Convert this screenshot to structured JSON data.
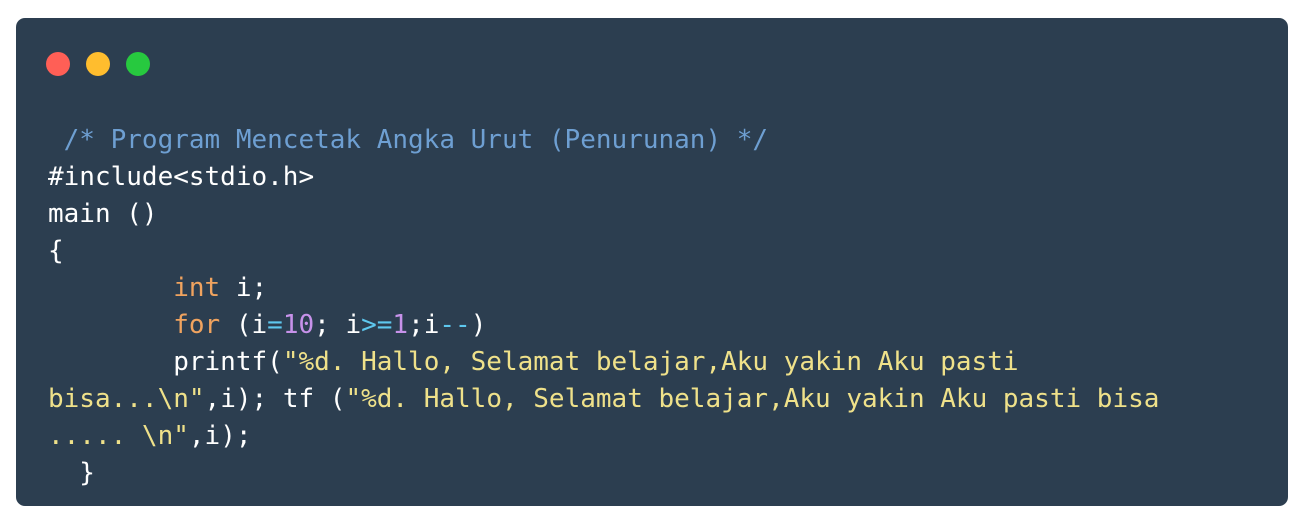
{
  "colors": {
    "window_bg": "#2c3e50",
    "dot_red": "#ff5f56",
    "dot_yellow": "#ffbd2e",
    "dot_green": "#27c93f",
    "default": "#ffffff",
    "comment": "#6e9fd2",
    "keyword": "#f0a35f",
    "string": "#efe18a",
    "number": "#c792ea",
    "operator": "#5ec8ef"
  },
  "window_controls": [
    "close",
    "minimize",
    "zoom"
  ],
  "code_lines": [
    [
      {
        "text": " /* Program Mencetak Angka Urut (Penurunan) */",
        "type": "comment"
      }
    ],
    [
      {
        "text": "#include<stdio.h>",
        "type": "default"
      }
    ],
    [
      {
        "text": "main ()",
        "type": "default"
      }
    ],
    [
      {
        "text": "{",
        "type": "default"
      }
    ],
    [
      {
        "text": "        ",
        "type": "default"
      },
      {
        "text": "int",
        "type": "keyword"
      },
      {
        "text": " i;",
        "type": "default"
      }
    ],
    [
      {
        "text": "        ",
        "type": "default"
      },
      {
        "text": "for",
        "type": "keyword"
      },
      {
        "text": " (i",
        "type": "default"
      },
      {
        "text": "=",
        "type": "operator"
      },
      {
        "text": "10",
        "type": "number"
      },
      {
        "text": "; i",
        "type": "default"
      },
      {
        "text": ">=",
        "type": "operator"
      },
      {
        "text": "1",
        "type": "number"
      },
      {
        "text": ";i",
        "type": "default"
      },
      {
        "text": "--",
        "type": "operator"
      },
      {
        "text": ")",
        "type": "default"
      }
    ],
    [
      {
        "text": "        printf(",
        "type": "default"
      },
      {
        "text": "\"%d. Hallo, Selamat belajar,Aku yakin Aku pasti",
        "type": "string"
      }
    ],
    [
      {
        "text": "bisa...\\n\"",
        "type": "string"
      },
      {
        "text": ",i); tf (",
        "type": "default"
      },
      {
        "text": "\"%d. Hallo, Selamat belajar,Aku yakin Aku pasti bisa",
        "type": "string"
      }
    ],
    [
      {
        "text": "..... \\n\"",
        "type": "string"
      },
      {
        "text": ",i);",
        "type": "default"
      }
    ],
    [
      {
        "text": "  }",
        "type": "default"
      }
    ]
  ]
}
